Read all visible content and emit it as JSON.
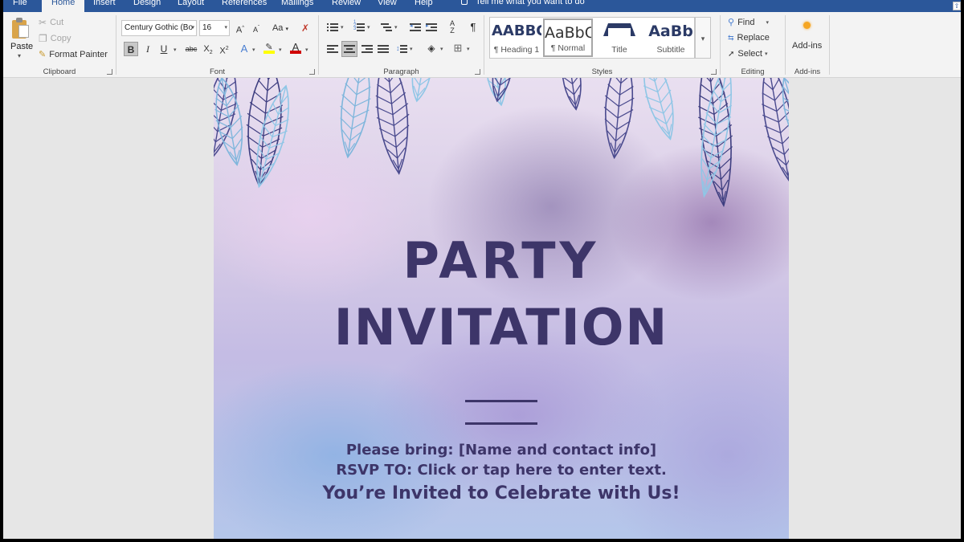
{
  "tabs": [
    "File",
    "Home",
    "Insert",
    "Design",
    "Layout",
    "References",
    "Mailings",
    "Review",
    "View",
    "Help"
  ],
  "tell_me": "Tell me what you want to do",
  "clipboard": {
    "paste": "Paste",
    "cut": "Cut",
    "copy": "Copy",
    "format_painter": "Format Painter",
    "label": "Clipboard"
  },
  "font": {
    "name": "Century Gothic (Bo",
    "size": "16",
    "label": "Font",
    "case_label": "Aa"
  },
  "paragraph": {
    "label": "Paragraph"
  },
  "styles": {
    "label": "Styles",
    "items": [
      {
        "preview": "AABBC",
        "name": "¶ Heading 1"
      },
      {
        "preview": "AaBbC",
        "name": "¶ Normal"
      },
      {
        "preview": "",
        "name": "Title"
      },
      {
        "preview": "AaBb",
        "name": "Subtitle"
      }
    ],
    "selected": "Normal"
  },
  "editing": {
    "find": "Find",
    "replace": "Replace",
    "select": "Select",
    "label": "Editing"
  },
  "addins": {
    "button": "Add-ins",
    "label": "Add-ins"
  },
  "document": {
    "heading_1": "PARTY",
    "heading_2": "INVITATION",
    "please_bring": "Please bring: [Name and contact info]",
    "rsvp": "RSVP TO: Click or tap here to enter text.",
    "invited": "You’re Invited to Celebrate with Us!"
  },
  "colors": {
    "ribbon_accent": "#2b579a",
    "text_purple": "#3d3569",
    "highlight": "#ffff00",
    "font_color": "#d00000"
  }
}
